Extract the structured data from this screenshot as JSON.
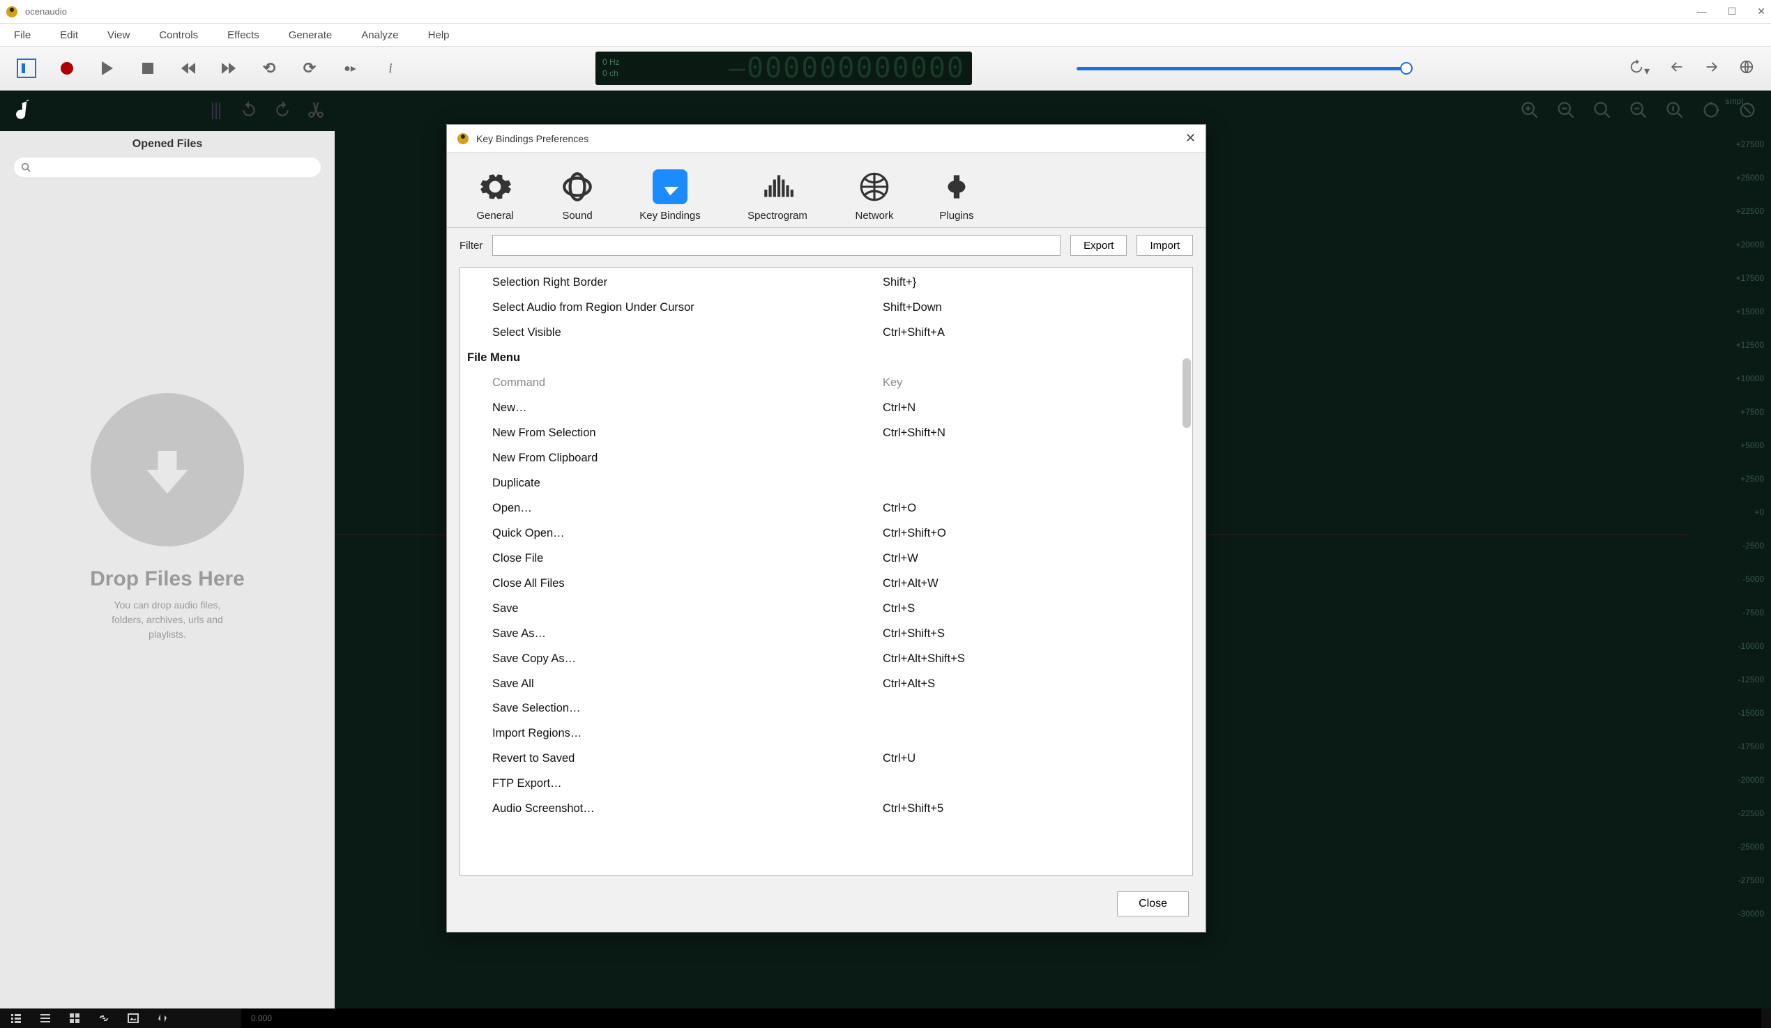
{
  "app": {
    "title": "ocenaudio"
  },
  "menu": [
    "File",
    "Edit",
    "View",
    "Controls",
    "Effects",
    "Generate",
    "Analyze",
    "Help"
  ],
  "lcd": {
    "hz": "0 Hz",
    "ch": "0 ch",
    "digits": "–000000000000"
  },
  "sidebar": {
    "heading": "Opened Files",
    "drop_title": "Drop Files Here",
    "drop_sub1": "You can drop audio files,",
    "drop_sub2": "folders, archives, urls and",
    "drop_sub3": "playlists."
  },
  "ruler": {
    "unit": "smpl",
    "ticks": [
      "+27500",
      "+25000",
      "+22500",
      "+20000",
      "+17500",
      "+15000",
      "+12500",
      "+10000",
      "+7500",
      "+5000",
      "+2500",
      "+0",
      "-2500",
      "-5000",
      "-7500",
      "-10000",
      "-12500",
      "-15000",
      "-17500",
      "-20000",
      "-22500",
      "-25000",
      "-27500",
      "-30000"
    ]
  },
  "status": {
    "readout": "0.000"
  },
  "dialog": {
    "title": "Key Bindings Preferences",
    "tabs": [
      "General",
      "Sound",
      "Key Bindings",
      "Spectrogram",
      "Network",
      "Plugins"
    ],
    "active_tab": "Key Bindings",
    "filter_label": "Filter",
    "export": "Export",
    "import": "Import",
    "close": "Close",
    "rows": [
      {
        "cmd": "Selection Right Border",
        "key": "Shift+}"
      },
      {
        "cmd": "Select Audio from Region Under Cursor",
        "key": "Shift+Down"
      },
      {
        "cmd": "Select Visible",
        "key": "Ctrl+Shift+A"
      }
    ],
    "section": "File Menu",
    "hdr_cmd": "Command",
    "hdr_key": "Key",
    "file_rows": [
      {
        "cmd": "New…",
        "key": "Ctrl+N"
      },
      {
        "cmd": "New From Selection",
        "key": "Ctrl+Shift+N"
      },
      {
        "cmd": "New From Clipboard",
        "key": ""
      },
      {
        "cmd": "Duplicate",
        "key": ""
      },
      {
        "cmd": "Open…",
        "key": "Ctrl+O"
      },
      {
        "cmd": "Quick Open…",
        "key": "Ctrl+Shift+O"
      },
      {
        "cmd": "Close File",
        "key": "Ctrl+W"
      },
      {
        "cmd": "Close All Files",
        "key": "Ctrl+Alt+W"
      },
      {
        "cmd": "Save",
        "key": "Ctrl+S"
      },
      {
        "cmd": "Save As…",
        "key": "Ctrl+Shift+S"
      },
      {
        "cmd": "Save Copy As…",
        "key": "Ctrl+Alt+Shift+S"
      },
      {
        "cmd": "Save All",
        "key": "Ctrl+Alt+S"
      },
      {
        "cmd": "Save Selection…",
        "key": ""
      },
      {
        "cmd": "Import Regions…",
        "key": ""
      },
      {
        "cmd": "Revert to Saved",
        "key": "Ctrl+U"
      },
      {
        "cmd": "FTP Export…",
        "key": ""
      },
      {
        "cmd": "Audio Screenshot…",
        "key": "Ctrl+Shift+5"
      }
    ]
  }
}
